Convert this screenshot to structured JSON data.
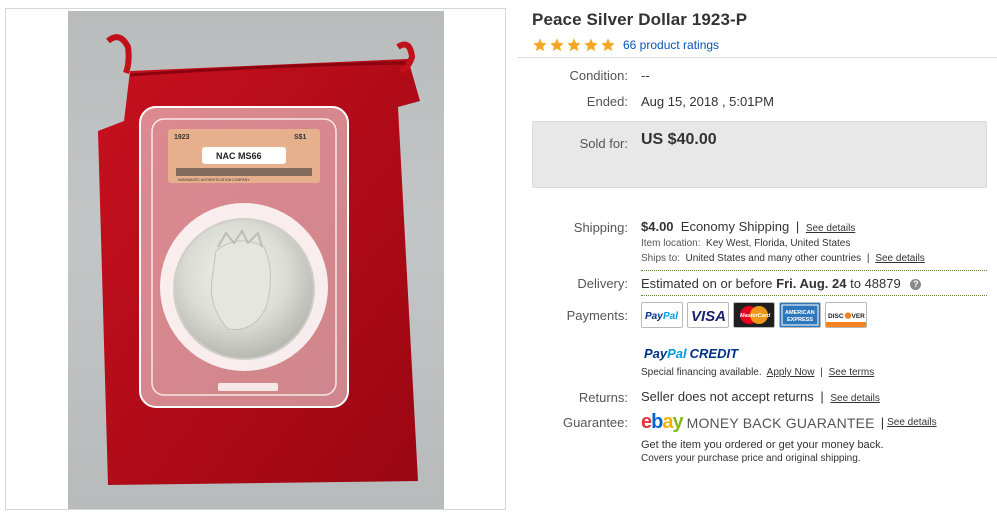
{
  "listing": {
    "title": "Peace Silver Dollar 1923-P",
    "ratings_text": "66 product ratings",
    "stars": 5,
    "star_color": "#f5a623"
  },
  "image": {
    "slab_year": "1923",
    "slab_denom": "S$1",
    "slab_grade": "NAC MS66",
    "slab_company": "NUMISMATIC AUTHENTICATION COMPANY"
  },
  "details": {
    "condition_label": "Condition:",
    "condition_value": "--",
    "ended_label": "Ended:",
    "ended_value": "Aug 15, 2018 , 5:01PM",
    "sold_label": "Sold for:",
    "sold_value": "US $40.00",
    "shipping_label": "Shipping:",
    "shipping_price": "$4.00",
    "shipping_method": "Economy Shipping",
    "shipping_details_link": "See details",
    "item_location_key": "Item location:",
    "item_location_value": "Key West, Florida, United States",
    "ships_to_key": "Ships to:",
    "ships_to_value": "United States and many other countries",
    "ships_to_details_link": "See details",
    "delivery_label": "Delivery:",
    "delivery_prefix": "Estimated on or before",
    "delivery_date": "Fri. Aug. 24",
    "delivery_to": "to",
    "delivery_zip": "48879",
    "payments_label": "Payments:",
    "payment_methods": [
      "PayPal",
      "VISA",
      "MasterCard",
      "AMERICAN EXPRESS",
      "DISCOVER"
    ],
    "ppcredit_pay": "Pay",
    "ppcredit_pal": "Pal",
    "ppcredit_credit": "CREDIT",
    "financing_text": "Special financing available.",
    "apply_now_link": "Apply Now",
    "see_terms_link": "See terms",
    "returns_label": "Returns:",
    "returns_value": "Seller does not accept returns",
    "returns_details_link": "See details",
    "guarantee_label": "Guarantee:",
    "ebay_logo_letters": [
      "e",
      "b",
      "a",
      "y"
    ],
    "ebay_logo_colors": [
      "#e53238",
      "#0064d2",
      "#f5af02",
      "#86b817"
    ],
    "mbg_text": "MONEY BACK GUARANTEE",
    "guarantee_details_link": "See details",
    "guarantee_line1": "Get the item you ordered or get your money back.",
    "guarantee_line2": "Covers your purchase price and original shipping."
  }
}
